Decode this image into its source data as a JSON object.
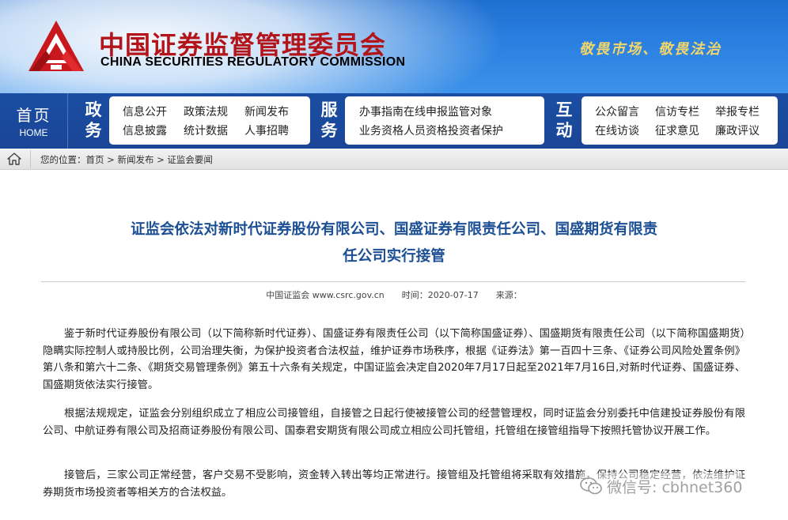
{
  "header": {
    "title_cn": "中国证券监督管理委员会",
    "title_en": "CHINA SECURITIES REGULATORY COMMISSION",
    "slogan": "敬畏市场、敬畏法治"
  },
  "nav": {
    "home_cn": "首页",
    "home_en": "HOME",
    "groups": [
      {
        "label_1": "政",
        "label_2": "务",
        "rows": [
          [
            "信息公开",
            "政策法规",
            "新闻发布"
          ],
          [
            "信息披露",
            "统计数据",
            "人事招聘"
          ]
        ]
      },
      {
        "label_1": "服",
        "label_2": "务",
        "rows": [
          [
            "办事指南",
            "在线申报",
            "监管对象"
          ],
          [
            "业务资格",
            "人员资格",
            "投资者保护"
          ]
        ]
      },
      {
        "label_1": "互",
        "label_2": "动",
        "rows": [
          [
            "公众留言",
            "信访专栏",
            "举报专栏"
          ],
          [
            "在线访谈",
            "征求意见",
            "廉政评议"
          ]
        ]
      }
    ]
  },
  "breadcrumb": {
    "prefix": "您的位置：",
    "items": [
      "首页",
      "新闻发布",
      "证监会要闻"
    ],
    "sep": " > "
  },
  "article": {
    "title_line1": "证监会依法对新时代证券股份有限公司、国盛证券有限责任公司、国盛期货有限责",
    "title_line2": "任公司实行接管",
    "source": "中国证监会 www.csrc.gov.cn",
    "time_label": "时间：2020-07-17",
    "origin_label": "来源：",
    "paragraphs": [
      "鉴于新时代证券股份有限公司（以下简称新时代证券）、国盛证券有限责任公司（以下简称国盛证券）、国盛期货有限责任公司（以下简称国盛期货）隐瞒实际控制人或持股比例，公司治理失衡，为保护投资者合法权益，维护证券市场秩序，根据《证券法》第一百四十三条、《证券公司风险处置条例》第八条和第六十二条、《期货交易管理条例》第五十六条有关规定，中国证监会决定自2020年7月17日起至2021年7月16日,对新时代证券、国盛证券、国盛期货依法实行接管。",
      "根据法规规定，证监会分别组织成立了相应公司接管组，自接管之日起行使被接管公司的经营管理权，同时证监会分别委托中信建投证券股份有限公司、中航证券有限公司及招商证券股份有限公司、国泰君安期货有限公司成立相应公司托管组，托管组在接管组指导下按照托管协议开展工作。",
      "接管后，三家公司正常经营，客户交易不受影响，资金转入转出等均正常进行。接管组及托管组将采取有效措施，保持公司稳定经营，依法维护证券期货市场投资者等相关方的合法权益。"
    ]
  },
  "watermark": {
    "text": "微信号: cbhnet360"
  },
  "colors": {
    "header_blue": "#2a80e0",
    "nav_blue": "#1b4596",
    "title_red": "#b31419",
    "article_title_blue": "#1c4f94",
    "slogan_gold": "#f3d66a"
  },
  "icons": {
    "logo": "csrc-logo",
    "breadcrumb_home": "home-icon",
    "watermark": "wechat-icon"
  }
}
